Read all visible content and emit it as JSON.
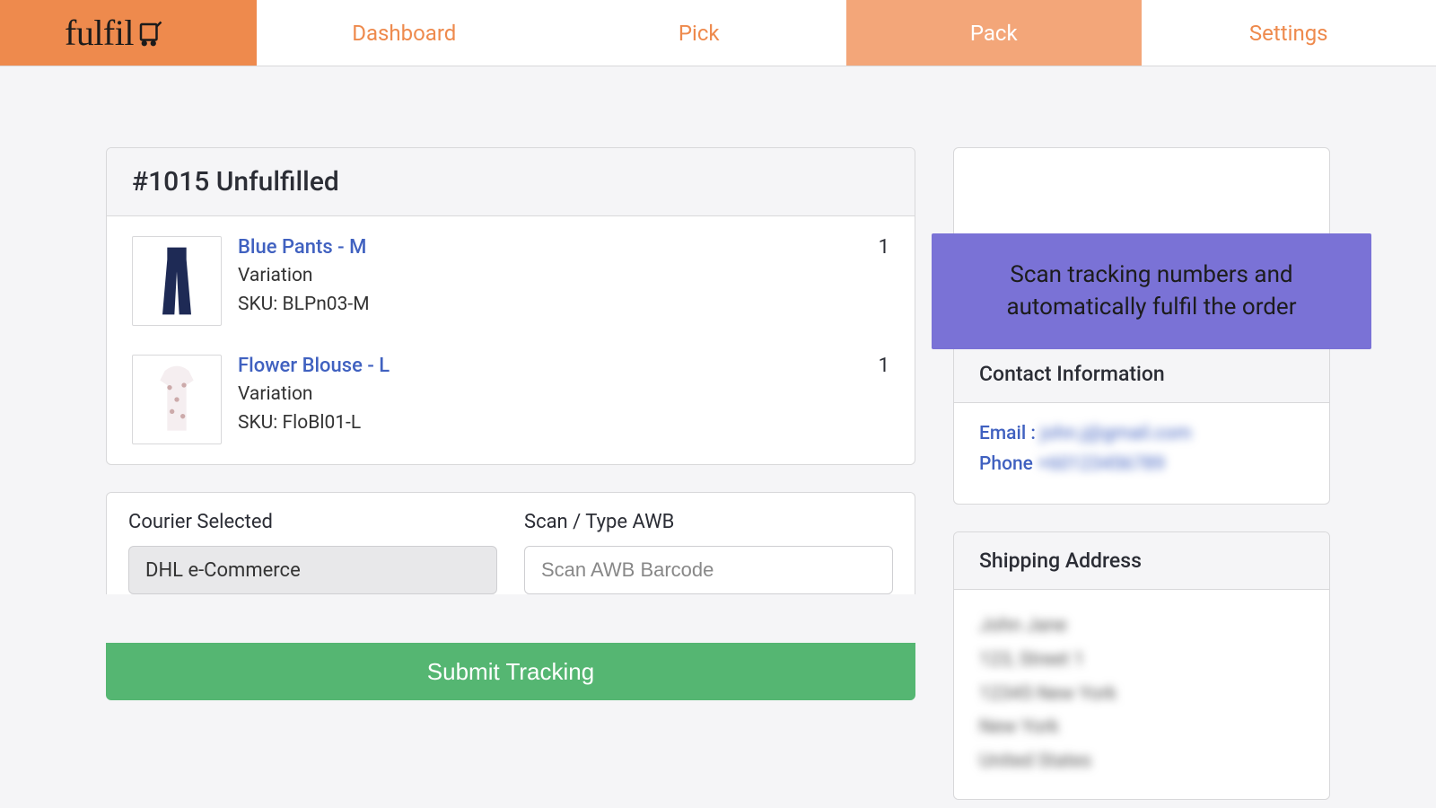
{
  "brand": "fulfil",
  "nav": {
    "items": [
      {
        "label": "Dashboard",
        "active": false
      },
      {
        "label": "Pick",
        "active": false
      },
      {
        "label": "Pack",
        "active": true
      },
      {
        "label": "Settings",
        "active": false
      }
    ]
  },
  "order": {
    "header": "#1015 Unfulfilled",
    "lines": [
      {
        "title": "Blue Pants - M",
        "variation": "Variation",
        "sku": "SKU: BLPn03-M",
        "qty": "1",
        "icon": "pants"
      },
      {
        "title": "Flower Blouse - L",
        "variation": "Variation",
        "sku": "SKU: FloBl01-L",
        "qty": "1",
        "icon": "blouse"
      }
    ]
  },
  "form": {
    "courier_label": "Courier Selected",
    "courier_value": "DHL e-Commerce",
    "awb_label": "Scan / Type AWB",
    "awb_placeholder": "Scan AWB Barcode",
    "submit": "Submit Tracking"
  },
  "contact": {
    "header": "Contact Information",
    "email_label": "Email :",
    "email_value": "john.j@gmail.com",
    "phone_label": "Phone",
    "phone_value": "+60123456789"
  },
  "shipping": {
    "header": "Shipping Address",
    "lines": [
      "John Jane",
      "123, Street 1",
      "12345 New York",
      "New York",
      "United States"
    ]
  },
  "tooltip": "Scan tracking numbers and automatically fulfil the order"
}
